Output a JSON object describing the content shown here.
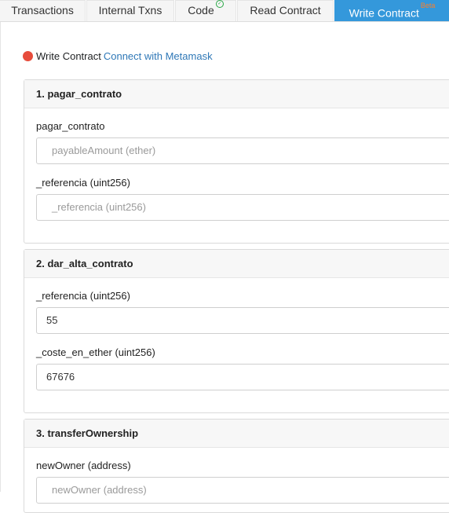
{
  "tabs": [
    {
      "label": "Transactions"
    },
    {
      "label": "Internal Txns"
    },
    {
      "label": "Code"
    },
    {
      "label": "Read Contract"
    },
    {
      "label": "Write Contract",
      "badge": "Beta"
    }
  ],
  "status": {
    "text": "Write Contract",
    "link": "Connect with Metamask",
    "dot_color": "#e74c3c"
  },
  "functions": [
    {
      "title": "1. pagar_contrato",
      "fields": [
        {
          "label": "pagar_contrato",
          "placeholder": "payableAmount (ether)",
          "value": ""
        },
        {
          "label": "_referencia (uint256)",
          "placeholder": "_referencia (uint256)",
          "value": ""
        }
      ]
    },
    {
      "title": "2. dar_alta_contrato",
      "fields": [
        {
          "label": "_referencia (uint256)",
          "placeholder": "_referencia (uint256)",
          "value": "55"
        },
        {
          "label": "_coste_en_ether (uint256)",
          "placeholder": "_coste_en_ether (uint256)",
          "value": "67676"
        }
      ]
    },
    {
      "title": "3. transferOwnership",
      "fields": [
        {
          "label": "newOwner (address)",
          "placeholder": "newOwner (address)",
          "value": ""
        }
      ]
    }
  ]
}
